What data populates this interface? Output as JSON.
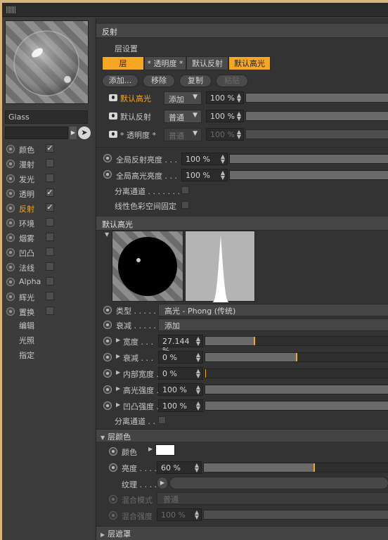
{
  "material": {
    "name": "Glass"
  },
  "channels": [
    {
      "label": "颜色",
      "checked": true,
      "active": false
    },
    {
      "label": "漫射",
      "checked": false,
      "active": false
    },
    {
      "label": "发光",
      "checked": false,
      "active": false
    },
    {
      "label": "透明",
      "checked": true,
      "active": false
    },
    {
      "label": "反射",
      "checked": true,
      "active": true
    },
    {
      "label": "环境",
      "checked": false,
      "active": false
    },
    {
      "label": "烟雾",
      "checked": false,
      "active": false
    },
    {
      "label": "凹凸",
      "checked": false,
      "active": false
    },
    {
      "label": "法线",
      "checked": false,
      "active": false
    },
    {
      "label": "Alpha",
      "checked": false,
      "active": false
    },
    {
      "label": "辉光",
      "checked": false,
      "active": false
    },
    {
      "label": "置换",
      "checked": false,
      "active": false
    }
  ],
  "extra_items": [
    "编辑",
    "光照",
    "指定"
  ],
  "check_glyph": "✓",
  "section_reflect": {
    "title": "反射",
    "layer_settings": "层设置",
    "tabs": [
      {
        "label": "层",
        "active": true
      },
      {
        "label": "* 透明度 *",
        "active": false
      },
      {
        "label": "默认反射",
        "active": false
      },
      {
        "label": "默认高光",
        "active": true
      }
    ],
    "buttons": [
      {
        "label": "添加...",
        "disabled": false
      },
      {
        "label": "移除",
        "disabled": false
      },
      {
        "label": "复制",
        "disabled": false
      },
      {
        "label": "粘贴",
        "disabled": true
      }
    ],
    "layers": [
      {
        "name": "默认高光",
        "mode": "添加",
        "value": "100 %",
        "highlight": true,
        "disabled": false
      },
      {
        "name": "默认反射",
        "mode": "普通",
        "value": "100 %",
        "highlight": false,
        "disabled": false
      },
      {
        "name": "* 透明度 *",
        "mode": "普通",
        "value": "100 %",
        "highlight": false,
        "disabled": true
      }
    ],
    "global_reflect_label": "全局反射亮度 . . .",
    "global_reflect_value": "100 %",
    "global_spec_label": "全局高光亮度 . . .",
    "global_spec_value": "100 %",
    "separate_pass_label": "分离通道 . . . . . . .",
    "linear_label": "线性色彩空间固定"
  },
  "section_spec": {
    "title": "默认高光",
    "type_label": "类型",
    "type_value": "高光 - Phong (传统)",
    "atten_label": "衰减",
    "atten_value": "添加",
    "params": [
      {
        "label": "宽度",
        "value": "27.144 %",
        "level": 0.27
      },
      {
        "label": "衰减",
        "value": "0 %",
        "level": 0.5
      },
      {
        "label": "内部宽度",
        "value": "0 %",
        "level": 0
      },
      {
        "label": "高光强度",
        "value": "100 %",
        "level": 1
      },
      {
        "label": "凹凸强度",
        "value": "100 %",
        "level": 1
      }
    ],
    "separate_pass_label": "分离通道 . ."
  },
  "layer_color": {
    "title": "层颜色",
    "color_label": "颜色",
    "color_value": "#ffffff",
    "brightness_label": "亮度",
    "brightness_value": "60 %",
    "brightness_level": 0.6,
    "texture_label": "纹理",
    "blend_mode_label": "混合模式",
    "blend_mode_value": "普通",
    "blend_strength_label": "混合强度",
    "blend_strength_value": "100 %"
  },
  "layer_mask": {
    "title": "层遮罩"
  },
  "colors": {
    "accent": "#f5a623",
    "panel": "#333333",
    "background": "#d6b67c"
  }
}
